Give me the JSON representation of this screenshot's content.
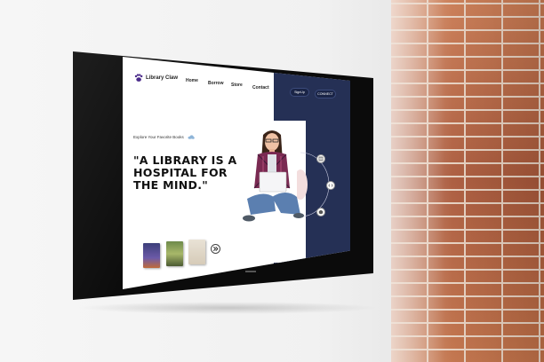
{
  "website": {
    "brand_name": "Library Claw",
    "nav": [
      "Home",
      "Borrow",
      "Store",
      "Contact"
    ],
    "signup_label": "SignUp",
    "connect_label": "CONNECT",
    "tagline": "Explore Your Favorite Books",
    "quote_lines": [
      "\"A LIBRARY IS A",
      "HOSPITAL FOR",
      "THE MIND.\""
    ],
    "feature_icons": [
      "book-icon",
      "code-icon",
      "box-icon"
    ],
    "book_cover_colors": [
      "#3c3f7a",
      "#6e8a4a",
      "#e9e2d6"
    ]
  },
  "colors": {
    "navy": "#253055",
    "button": "#1a2446",
    "brand_purple": "#4a2a8a",
    "brick": "#b5653f"
  }
}
